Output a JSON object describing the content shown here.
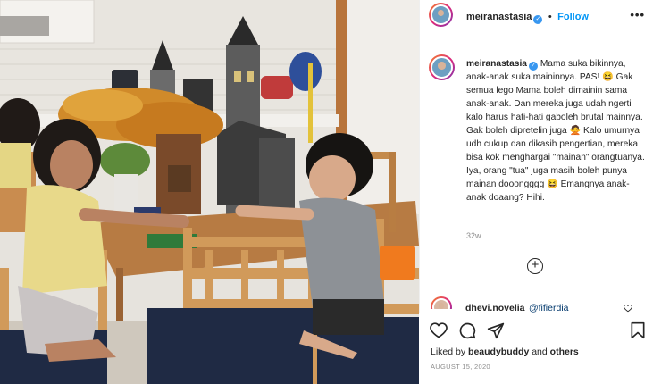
{
  "post": {
    "username": "meiranastasia",
    "verified_mark": "✓",
    "follow_label": "Follow",
    "more_label": "•••",
    "caption_username": "meiranastasia",
    "caption_text": "Mama suka bikinnya, anak-anak suka maininnya. PAS! 😆 Gak semua lego Mama boleh dimainin sama anak-anak. Dan mereka juga udah ngerti kalo harus hati-hati gaboleh brutal mainnya. Gak boleh dipretelin juga 🙅 Kalo umurnya udh cukup dan dikasih pengertian, mereka bisa kok menghargai \"mainan\" orangtuanya. Iya, orang \"tua\" juga masih boleh punya mainan dooongggg 😆 Emangnya anak-anak doaang? Hihi.",
    "time_ago": "32w",
    "load_more_label": "+",
    "comment": {
      "username": "dhevi.novelia",
      "text": "@fifierdia"
    },
    "likes_prefix": "Liked by",
    "likes_user": "beaudybuddy",
    "likes_mid": "and",
    "likes_suffix": "others",
    "date": "AUGUST 15, 2020"
  },
  "icons": {
    "more": "more-horizontal-icon",
    "like": "heart-icon",
    "comment": "comment-icon",
    "share": "share-icon",
    "save": "bookmark-icon",
    "add_comment": "plus-circle-icon"
  },
  "colors": {
    "link_blue": "#0095f6",
    "verified_blue": "#3897f0",
    "muted_grey": "#8e8e8e",
    "text_dark": "#262626"
  }
}
